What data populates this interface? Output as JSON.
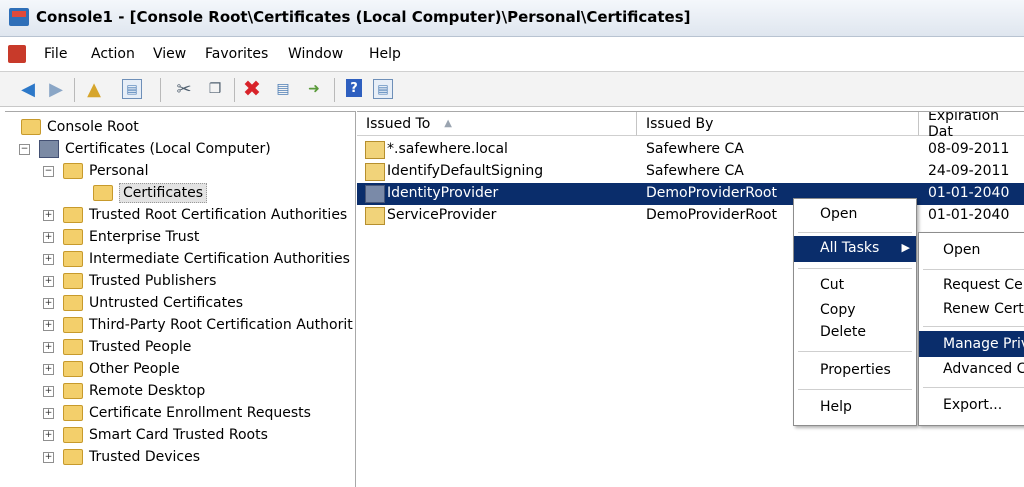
{
  "window": {
    "title": "Console1 - [Console Root\\Certificates (Local Computer)\\Personal\\Certificates]"
  },
  "menu": [
    "File",
    "Action",
    "View",
    "Favorites",
    "Window",
    "Help"
  ],
  "toolbar": [
    "back",
    "forward",
    "up-folder",
    "show-hide-tree",
    "cut",
    "copy",
    "delete",
    "properties",
    "export",
    "help",
    "show-hide-action-pane"
  ],
  "tree": {
    "root": "Console Root",
    "certs_local": "Certificates (Local Computer)",
    "personal": "Personal",
    "certificates": "Certificates",
    "stores": [
      "Trusted Root Certification Authorities",
      "Enterprise Trust",
      "Intermediate Certification Authorities",
      "Trusted Publishers",
      "Untrusted Certificates",
      "Third-Party Root Certification Authorit",
      "Trusted People",
      "Other People",
      "Remote Desktop",
      "Certificate Enrollment Requests",
      "Smart Card Trusted Roots",
      "Trusted Devices"
    ]
  },
  "columns": [
    "Issued To",
    "Issued By",
    "Expiration Dat"
  ],
  "certificates": [
    {
      "issued_to": "*.safewhere.local",
      "issued_by": "Safewhere CA",
      "expires": "08-09-2011"
    },
    {
      "issued_to": "IdentifyDefaultSigning",
      "issued_by": "Safewhere CA",
      "expires": "24-09-2011"
    },
    {
      "issued_to": "IdentityProvider",
      "issued_by": "DemoProviderRoot",
      "expires": "01-01-2040"
    },
    {
      "issued_to": "ServiceProvider",
      "issued_by": "DemoProviderRoot",
      "expires": "01-01-2040"
    }
  ],
  "context_menu": {
    "open": "Open",
    "all_tasks": "All Tasks",
    "cut": "Cut",
    "copy": "Copy",
    "delete": "Delete",
    "properties": "Properties",
    "help": "Help"
  },
  "submenu": {
    "open": "Open",
    "request": "Request Ce",
    "renew": "Renew Cert",
    "manage": "Manage Priv",
    "advanced": "Advanced C",
    "export": "Export..."
  },
  "colors": {
    "selection": "#0a2d6b",
    "menu_highlight": "#0a2d6b"
  }
}
